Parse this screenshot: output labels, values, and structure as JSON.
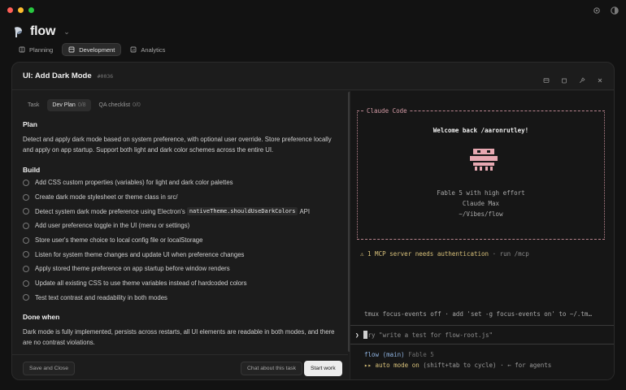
{
  "window": {
    "icons": [
      "gear-icon",
      "theme-icon"
    ]
  },
  "app": {
    "title": "flow",
    "chevron": "⌄"
  },
  "nav": {
    "tabs": [
      {
        "label": "Planning",
        "icon": "book-icon"
      },
      {
        "label": "Development",
        "icon": "box-icon",
        "active": true
      },
      {
        "label": "Analytics",
        "icon": "chart-icon"
      }
    ]
  },
  "task": {
    "title": "UI: Add Dark Mode",
    "id": "#0036",
    "actions": [
      "archive-icon",
      "trash-icon",
      "pin-icon",
      "close-icon"
    ]
  },
  "subtabs": [
    {
      "label": "Task",
      "count": ""
    },
    {
      "label": "Dev Plan",
      "count": "0/8",
      "active": true
    },
    {
      "label": "QA checklist",
      "count": "0/0"
    }
  ],
  "plan": {
    "heading": "Plan",
    "text": "Detect and apply dark mode based on system preference, with optional user override. Store preference locally and apply on app startup. Support both light and dark color schemes across the entire UI."
  },
  "build": {
    "heading": "Build",
    "items": [
      {
        "text": "Add CSS custom properties (variables) for light and dark color palettes"
      },
      {
        "text": "Create dark mode stylesheet or theme class in src/"
      },
      {
        "text": "Detect system dark mode preference using Electron's",
        "code": "nativeTheme.shouldUseDarkColors",
        "suffix": "API"
      },
      {
        "text": "Add user preference toggle in the UI (menu or settings)"
      },
      {
        "text": "Store user's theme choice to local config file or localStorage"
      },
      {
        "text": "Listen for system theme changes and update UI when preference changes"
      },
      {
        "text": "Apply stored theme preference on app startup before window renders"
      },
      {
        "text": "Update all existing CSS to use theme variables instead of hardcoded colors"
      },
      {
        "text": "Test text contrast and readability in both modes"
      }
    ]
  },
  "done": {
    "heading": "Done when",
    "text": "Dark mode is fully implemented, persists across restarts, all UI elements are readable in both modes, and there are no contrast violations."
  },
  "footer": {
    "save_label": "Save and Close",
    "chat_label": "Chat about this task",
    "start_label": "Start work"
  },
  "terminal": {
    "box_label": "Claude Code",
    "welcome": "Welcome back /aaronrutley!",
    "model": "Fable 5 with high effort",
    "plan": "Claude Max",
    "path": "~/Vibes/flow",
    "mcp_warn": "⚠ 1 MCP server needs authentication",
    "mcp_hint": "· run /mcp",
    "tmux": "tmux focus-events off · add 'set -g focus-events on' to ~/.tm…",
    "prompt_char": "❯",
    "prompt_placeholder": "ry \"write a test for flow-root.js\"",
    "status_branch": "flow (main)",
    "status_model": "Fable 5",
    "status_mode": "▸▸ auto mode on",
    "status_hint": "(shift+tab to cycle) · ← for agents"
  },
  "colors": {
    "accent_pink": "#d29aa4",
    "mascot": "#e7a8b1",
    "warning": "#d8c17a",
    "branch": "#8fb3e0"
  }
}
